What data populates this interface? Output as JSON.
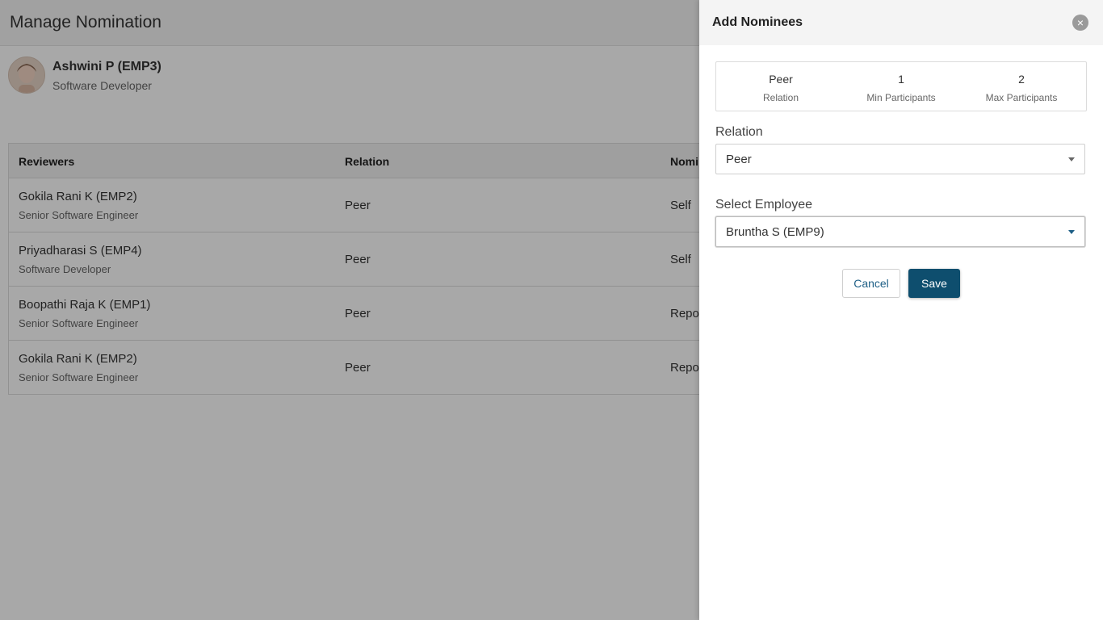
{
  "page": {
    "title": "Manage Nomination",
    "employee": {
      "name": "Ashwini P (EMP3)",
      "role": "Software Developer"
    }
  },
  "table": {
    "headers": [
      "Reviewers",
      "Relation",
      "Nomi"
    ],
    "rows": [
      {
        "name": "Gokila Rani K (EMP2)",
        "title": "Senior Software Engineer",
        "relation": "Peer",
        "nominated_by": "Self"
      },
      {
        "name": "Priyadharasi S (EMP4)",
        "title": "Software Developer",
        "relation": "Peer",
        "nominated_by": "Self"
      },
      {
        "name": "Boopathi Raja K (EMP1)",
        "title": "Senior Software Engineer",
        "relation": "Peer",
        "nominated_by": "Repor"
      },
      {
        "name": "Gokila Rani K (EMP2)",
        "title": "Senior Software Engineer",
        "relation": "Peer",
        "nominated_by": "Repor"
      }
    ]
  },
  "drawer": {
    "title": "Add Nominees",
    "close_icon": "×",
    "summary": [
      {
        "value": "Peer",
        "label": "Relation"
      },
      {
        "value": "1",
        "label": "Min Participants"
      },
      {
        "value": "2",
        "label": "Max Participants"
      }
    ],
    "relation_label": "Relation",
    "relation_value": "Peer",
    "employee_label": "Select Employee",
    "employee_value": "Bruntha S (EMP9)",
    "cancel_label": "Cancel",
    "save_label": "Save"
  },
  "colors": {
    "primary": "#0e4e6e",
    "overlay": "rgba(0,0,0,0.34)"
  }
}
